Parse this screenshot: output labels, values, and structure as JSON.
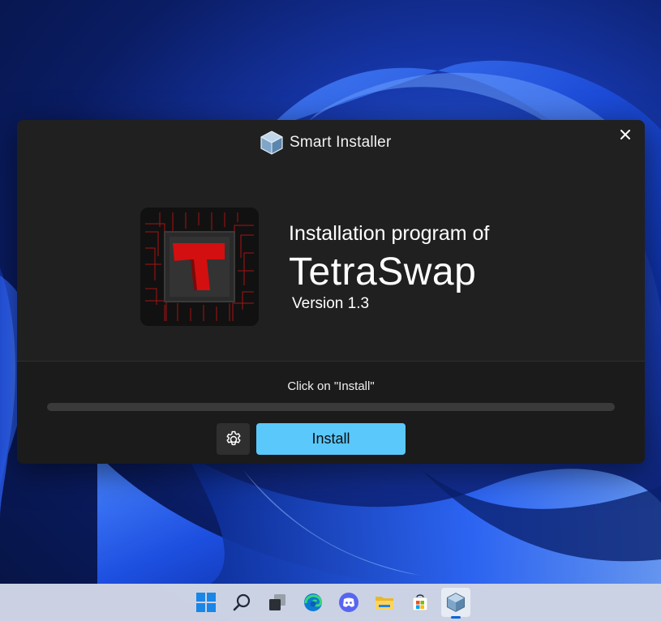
{
  "window": {
    "title": "Smart Installer",
    "close_icon": "close-icon",
    "app_icon": "box-icon"
  },
  "content": {
    "line1": "Installation program of",
    "product_name": "TetraSwap",
    "version": "Version 1.3",
    "logo": "tetraswap-logo"
  },
  "footer": {
    "status": "Click on \"Install\"",
    "progress": 0,
    "settings_icon": "gear-icon",
    "install_label": "Install"
  },
  "taskbar": {
    "icons": [
      "windows-start-icon",
      "search-icon",
      "task-view-icon",
      "edge-icon",
      "discord-icon",
      "file-explorer-icon",
      "microsoft-store-icon",
      "smart-installer-icon"
    ],
    "active": "smart-installer-icon"
  },
  "colors": {
    "accent": "#5ac8fa",
    "window_bg": "#202020",
    "footer_bg": "#1b1b1b",
    "logo_red": "#d40f0f"
  }
}
